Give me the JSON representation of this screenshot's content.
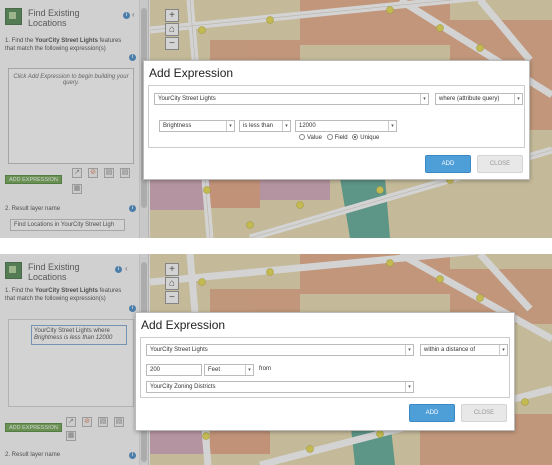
{
  "colors": {
    "accent": "#4e9ed8",
    "add_expression_green": "#5c9a3a",
    "map_parcels": "#e29a6e",
    "map_highlight": "#4aa08a"
  },
  "shot1": {
    "panel": {
      "title": "Find Existing Locations",
      "step1_prefix": "1. Find the ",
      "step1_layer": "YourCity Street Lights",
      "step1_suffix": " features that match the following expression(s)",
      "expression_placeholder": "Click Add Expression to begin building your query.",
      "add_expression_label": "ADD EXPRESSION",
      "step2_label": "2. Result layer name",
      "result_name": "Find Locations in YourCity Street Ligh"
    },
    "dialog": {
      "title": "Add Expression",
      "layer_select": "YourCity Street Lights",
      "mode_select": "where (attribute query)",
      "field_select": "Brightness",
      "operator_select": "is less than",
      "value_select": "12000",
      "radio_value": "Value",
      "radio_field": "Field",
      "radio_unique": "Unique",
      "add_label": "ADD",
      "close_label": "CLOSE"
    }
  },
  "shot2": {
    "panel": {
      "title": "Find Existing Locations",
      "step1_prefix": "1. Find the ",
      "step1_layer": "YourCity Street Lights",
      "step1_suffix": " features that match the following expression(s)",
      "expr_layer": "YourCity Street Lights",
      "expr_where": " where ",
      "expr_condition": "Brightness is less than 12000",
      "add_expression_label": "ADD EXPRESSION",
      "step2_label": "2. Result layer name"
    },
    "dialog": {
      "title": "Add Expression",
      "layer_select": "YourCity Street Lights",
      "mode_select": "within a distance of",
      "distance_value": "200",
      "unit_select": "Feet",
      "from_label": "from",
      "target_select": "YourCity Zoning Districts",
      "add_label": "ADD",
      "close_label": "CLOSE"
    }
  }
}
